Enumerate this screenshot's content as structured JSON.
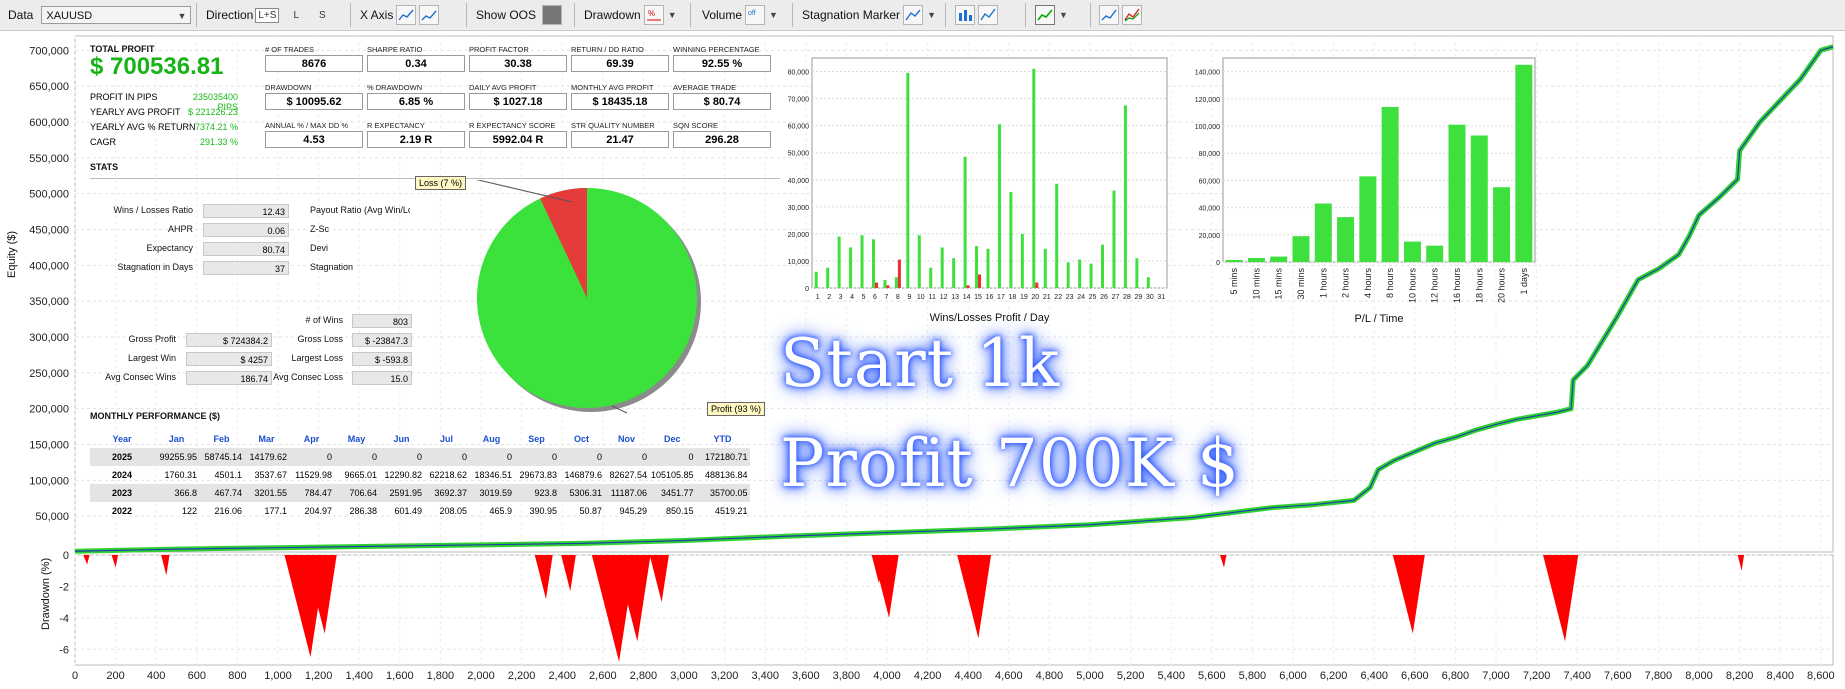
{
  "toolbar": {
    "data_label": "Data",
    "symbol": "XAUUSD",
    "direction_label": "Direction",
    "direction_options": [
      "L+S",
      "L",
      "S"
    ],
    "xaxis_label": "X Axis",
    "show_oos_label": "Show OOS",
    "drawdown_label": "Drawdown",
    "volume_label": "Volume",
    "stagnation_label": "Stagnation Marker"
  },
  "summary": {
    "total_profit_label": "TOTAL PROFIT",
    "total_profit": "$ 700536.81",
    "rows": [
      {
        "label": "PROFIT IN PIPS",
        "value": "235035400 PIPS"
      },
      {
        "label": "YEARLY AVG PROFIT",
        "value": "$ 221226.23"
      },
      {
        "label": "YEARLY AVG % RETURN",
        "value": "7374.21 %"
      },
      {
        "label": "CAGR",
        "value": "291.33 %"
      }
    ]
  },
  "kpis": [
    {
      "label": "# OF TRADES",
      "value": "8676"
    },
    {
      "label": "SHARPE RATIO",
      "value": "0.34"
    },
    {
      "label": "PROFIT FACTOR",
      "value": "30.38"
    },
    {
      "label": "RETURN / DD RATIO",
      "value": "69.39"
    },
    {
      "label": "WINNING PERCENTAGE",
      "value": "92.55 %"
    },
    {
      "label": "DRAWDOWN",
      "value": "$ 10095.62"
    },
    {
      "label": "% DRAWDOWN",
      "value": "6.85 %"
    },
    {
      "label": "DAILY AVG PROFIT",
      "value": "$ 1027.18"
    },
    {
      "label": "MONTHLY AVG PROFIT",
      "value": "$ 18435.18"
    },
    {
      "label": "AVERAGE TRADE",
      "value": "$ 80.74"
    },
    {
      "label": "ANNUAL % / MAX DD %",
      "value": "4.53"
    },
    {
      "label": "R EXPECTANCY",
      "value": "2.19 R"
    },
    {
      "label": "R EXPECTANCY SCORE",
      "value": "5992.04 R"
    },
    {
      "label": "STR QUALITY NUMBER",
      "value": "21.47"
    },
    {
      "label": "SQN SCORE",
      "value": "296.28"
    }
  ],
  "stats": {
    "title": "STATS",
    "left": [
      {
        "label": "Wins / Losses Ratio",
        "value": "12.43"
      },
      {
        "label": "AHPR",
        "value": "0.06"
      },
      {
        "label": "Expectancy",
        "value": "80.74"
      },
      {
        "label": "Stagnation in Days",
        "value": "37"
      }
    ],
    "right_labels": [
      "Payout Ratio (Avg Win/Lo",
      "Z-Sc",
      "Devi",
      "Stagnation "
    ],
    "bottom_left": [
      {
        "label": "Gross Profit",
        "value": "$ 724384.2"
      },
      {
        "label": "Largest Win",
        "value": "$ 4257"
      },
      {
        "label": "Avg Consec Wins",
        "value": "186.74"
      }
    ],
    "bottom_right": [
      {
        "label": "# of Wins",
        "value": "803"
      },
      {
        "label": "Gross Loss",
        "value": "$ -23847.3"
      },
      {
        "label": "Largest Loss",
        "value": "$ -593.8"
      },
      {
        "label": "Avg Consec Loss",
        "value": "15.0"
      }
    ]
  },
  "pie": {
    "loss_label": "Loss (7 %)",
    "profit_label": "Profit (93 %)",
    "loss_fraction": 0.07,
    "colors": {
      "profit": "#3be23b",
      "loss": "#e63b3b"
    }
  },
  "monthly": {
    "title": "MONTHLY PERFORMANCE ($)",
    "headers": [
      "Year",
      "Jan",
      "Feb",
      "Mar",
      "Apr",
      "May",
      "Jun",
      "Jul",
      "Aug",
      "Sep",
      "Oct",
      "Nov",
      "Dec",
      "YTD"
    ],
    "rows": [
      [
        "2025",
        "99255.95",
        "58745.14",
        "14179.62",
        "0",
        "0",
        "0",
        "0",
        "0",
        "0",
        "0",
        "0",
        "0",
        "172180.71"
      ],
      [
        "2024",
        "1760.31",
        "4501.1",
        "3537.67",
        "11529.98",
        "9665.01",
        "12290.82",
        "62218.62",
        "18346.51",
        "29673.83",
        "146879.6",
        "82627.54",
        "105105.85",
        "488136.84"
      ],
      [
        "2023",
        "366.8",
        "467.74",
        "3201.55",
        "784.47",
        "706.64",
        "2591.95",
        "3692.37",
        "3019.59",
        "923.8",
        "5306.31",
        "11187.06",
        "3451.77",
        "35700.05"
      ],
      [
        "2022",
        "122",
        "216.06",
        "177.1",
        "204.97",
        "286.38",
        "601.49",
        "208.05",
        "465.9",
        "390.95",
        "50.87",
        "945.29",
        "850.15",
        "4519.21"
      ]
    ]
  },
  "overlay": {
    "line1": "Start 1k",
    "line2": "Profit 700K $"
  },
  "chart_data": [
    {
      "type": "line",
      "ylabel": "Equity ($)",
      "xlabel": "",
      "xlim": [
        0,
        8660
      ],
      "ylim": [
        0,
        720000
      ],
      "yticks": [
        "50,000",
        "100,000",
        "150,000",
        "200,000",
        "250,000",
        "300,000",
        "350,000",
        "400,000",
        "450,000",
        "500,000",
        "550,000",
        "600,000",
        "650,000",
        "700,000"
      ],
      "xticks": [
        "0",
        "200",
        "400",
        "600",
        "800",
        "1,000",
        "1,200",
        "1,400",
        "1,600",
        "1,800",
        "2,000",
        "2,200",
        "2,400",
        "2,600",
        "2,800",
        "3,000",
        "3,200",
        "3,400",
        "3,600",
        "3,800",
        "4,000",
        "4,200",
        "4,400",
        "4,600",
        "4,800",
        "5,000",
        "5,200",
        "5,400",
        "5,600",
        "5,800",
        "6,000",
        "6,200",
        "6,400",
        "6,600",
        "6,800",
        "7,000",
        "7,200",
        "7,400",
        "7,600",
        "7,800",
        "8,000",
        "8,200",
        "8,400",
        "8,600"
      ],
      "x": [
        0,
        500,
        1000,
        1500,
        2000,
        2500,
        3000,
        3500,
        4000,
        4500,
        5000,
        5500,
        5900,
        6100,
        6300,
        6380,
        6420,
        6500,
        6600,
        6700,
        6800,
        6900,
        7000,
        7100,
        7300,
        7370,
        7380,
        7450,
        7600,
        7700,
        7800,
        7900,
        7950,
        8000,
        8100,
        8190,
        8200,
        8300,
        8400,
        8500,
        8600,
        8660
      ],
      "y": [
        1000,
        4000,
        6000,
        8000,
        10000,
        12000,
        16000,
        22000,
        27000,
        32000,
        38000,
        48000,
        62000,
        66000,
        72000,
        90000,
        115000,
        128000,
        140000,
        152000,
        160000,
        170000,
        178000,
        185000,
        195000,
        200000,
        240000,
        260000,
        330000,
        380000,
        395000,
        415000,
        440000,
        470000,
        495000,
        520000,
        560000,
        600000,
        630000,
        660000,
        700000,
        705000
      ],
      "color": "#2fd12f"
    },
    {
      "type": "area",
      "ylabel": "Drawdown (%)",
      "ylim": [
        -7,
        0
      ],
      "yticks": [
        "-6",
        "-4",
        "-2",
        "0"
      ],
      "x": [
        60,
        200,
        450,
        1160,
        1230,
        2320,
        2440,
        2680,
        2770,
        2890,
        3960,
        4010,
        4450,
        5660,
        6590,
        7340,
        8210
      ],
      "y": [
        -0.6,
        -0.8,
        -1.3,
        -6.5,
        -5.0,
        -2.8,
        -2.3,
        -6.8,
        -5.5,
        -3.0,
        -1.8,
        -4.0,
        -5.3,
        -0.8,
        -5.0,
        -5.5,
        -1.0
      ],
      "color": "#ff0000"
    },
    {
      "type": "bar",
      "xlabel": "Wins/Losses Profit / Day",
      "ylim": [
        0,
        85000
      ],
      "yticks": [
        "0",
        "10,000",
        "20,000",
        "30,000",
        "40,000",
        "50,000",
        "60,000",
        "70,000",
        "80,000"
      ],
      "categories": [
        "1",
        "2",
        "3",
        "4",
        "5",
        "6",
        "7",
        "8",
        "9",
        "10",
        "11",
        "12",
        "13",
        "14",
        "15",
        "16",
        "17",
        "18",
        "19",
        "20",
        "21",
        "22",
        "23",
        "24",
        "25",
        "26",
        "27",
        "28",
        "29",
        "30",
        "31"
      ],
      "series": [
        {
          "values": [
            6000,
            7500,
            19000,
            15000,
            19500,
            18000,
            3000,
            4000,
            79500,
            19500,
            7500,
            15000,
            11000,
            48500,
            15500,
            14500,
            60500,
            35500,
            20000,
            81000,
            14500,
            38500,
            9500,
            10500,
            9000,
            16000,
            36000,
            67500,
            11000,
            4000,
            0
          ]
        },
        {
          "values": [
            0,
            0,
            0,
            0,
            0,
            2000,
            1000,
            10500,
            0,
            0,
            0,
            0,
            0,
            1000,
            5000,
            0,
            0,
            0,
            0,
            2000,
            0,
            0,
            0,
            0,
            0,
            0,
            0,
            0,
            0,
            0,
            0
          ]
        }
      ],
      "colors": [
        "#3ee03e",
        "#e83030"
      ]
    },
    {
      "type": "bar",
      "xlabel": "P/L / Time",
      "ylim": [
        0,
        150000
      ],
      "yticks": [
        "0",
        "20,000",
        "40,000",
        "60,000",
        "80,000",
        "100,000",
        "120,000",
        "140,000"
      ],
      "categories": [
        "5 mins",
        "10 mins",
        "15 mins",
        "30 mins",
        "1 hours",
        "2 hours",
        "4 hours",
        "8 hours",
        "10 hours",
        "12 hours",
        "16 hours",
        "18 hours",
        "20 hours",
        "1 days"
      ],
      "values": [
        1500,
        3000,
        4000,
        19000,
        43000,
        33000,
        63000,
        114000,
        15000,
        12000,
        101000,
        93000,
        55000,
        145000
      ],
      "color": "#3ee03e"
    }
  ]
}
